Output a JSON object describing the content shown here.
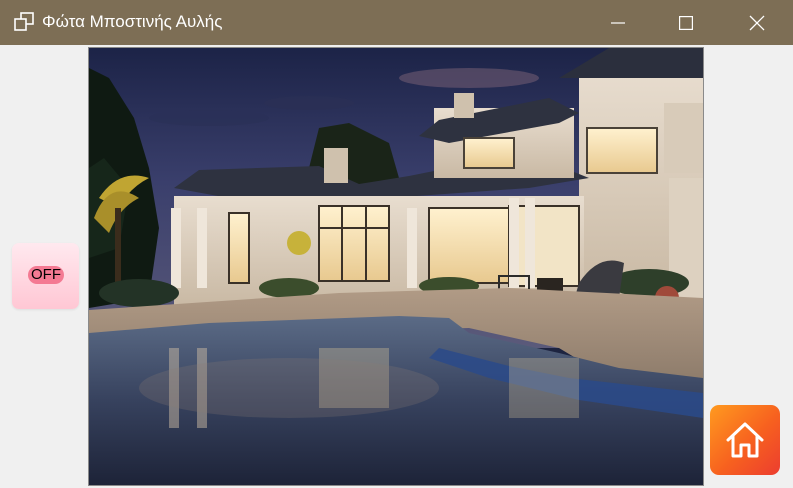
{
  "window": {
    "title": "Φώτα Μποστινής Αυλής",
    "controls": {
      "minimize_icon": "minimize-icon",
      "maximize_icon": "maximize-icon",
      "close_icon": "close-icon"
    }
  },
  "colors": {
    "titlebar": "#7d6e55",
    "toggle_background": "#ffc7d4",
    "toggle_pill": "#f47a93",
    "home_gradient_start": "#ff9a1f",
    "home_gradient_end": "#ec3d2f"
  },
  "toggle": {
    "label": "OFF",
    "state": "off"
  },
  "photo": {
    "subject": "villa-with-pool-at-dusk"
  },
  "home_button": {
    "icon": "home-icon"
  }
}
